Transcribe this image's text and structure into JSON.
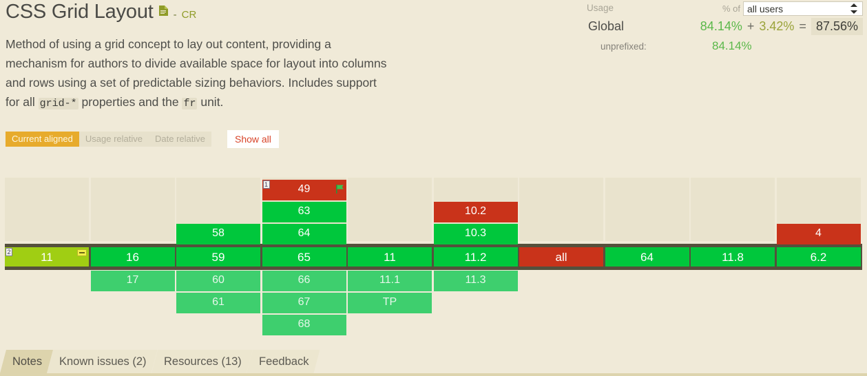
{
  "header": {
    "title": "CSS Grid Layout",
    "doc_icon": "document-icon",
    "dash": "-",
    "spec_status": "CR",
    "description_parts": {
      "p1": "Method of using a grid concept to lay out content, providing a mechanism for authors to divide available space for layout into columns and rows using a set of predictable sizing behaviors. Includes support for all ",
      "code1": "grid-*",
      "p2": " properties and the ",
      "code2": "fr",
      "p3": " unit."
    }
  },
  "usage": {
    "label": "Usage",
    "pct_of_label": "% of",
    "select_value": "all users",
    "global_label": "Global",
    "supported": "84.14%",
    "plus": "+",
    "partial": "3.42%",
    "equals": "=",
    "total": "87.56%",
    "unprefixed_label": "unprefixed:",
    "unprefixed_value": "84.14%"
  },
  "toolbar": {
    "segments": [
      {
        "label": "Current aligned",
        "active": true
      },
      {
        "label": "Usage relative",
        "active": false
      },
      {
        "label": "Date relative",
        "active": false
      }
    ],
    "show_all": "Show all"
  },
  "colors": {
    "page_bg": "#f0ead8",
    "empty_cell": "#e9e3cd",
    "supported": "#00c73c",
    "future": "#3ecf6e",
    "unsupported": "#c9331a",
    "partial": "#a0ce13",
    "highlight_band": "#55503c",
    "accent_orange": "#e7ab2c",
    "link_red": "#d8452a",
    "spec_green": "#8f9c28"
  },
  "support_grid": {
    "columns": [
      {
        "name": "ie",
        "above": [],
        "current": {
          "label": "11",
          "state": "partial",
          "badge": "2",
          "marker": "prefix-icon"
        },
        "below": []
      },
      {
        "name": "edge",
        "above": [],
        "current": {
          "label": "16",
          "state": "green"
        },
        "below": [
          {
            "label": "17",
            "state": "future"
          }
        ]
      },
      {
        "name": "firefox",
        "above": [
          {
            "label": "58",
            "state": "green"
          }
        ],
        "current": {
          "label": "59",
          "state": "green"
        },
        "below": [
          {
            "label": "60",
            "state": "future"
          },
          {
            "label": "61",
            "state": "future"
          }
        ]
      },
      {
        "name": "chrome",
        "above": [
          {
            "label": "49",
            "state": "red",
            "badge": "1",
            "marker": "flag-icon"
          },
          {
            "label": "63",
            "state": "green"
          },
          {
            "label": "64",
            "state": "green"
          }
        ],
        "current": {
          "label": "65",
          "state": "green"
        },
        "below": [
          {
            "label": "66",
            "state": "future"
          },
          {
            "label": "67",
            "state": "future"
          },
          {
            "label": "68",
            "state": "future"
          }
        ]
      },
      {
        "name": "safari",
        "above": [],
        "current": {
          "label": "11",
          "state": "green"
        },
        "below": [
          {
            "label": "11.1",
            "state": "future"
          },
          {
            "label": "TP",
            "state": "future"
          }
        ]
      },
      {
        "name": "opera",
        "above": [
          {
            "label": "10.2",
            "state": "red"
          },
          {
            "label": "10.3",
            "state": "green"
          }
        ],
        "current": {
          "label": "11.2",
          "state": "green"
        },
        "below": [
          {
            "label": "11.3",
            "state": "future"
          }
        ]
      },
      {
        "name": "ie-mobile",
        "above": [],
        "current": {
          "label": "all",
          "state": "red"
        },
        "below": []
      },
      {
        "name": "android-browser",
        "above": [],
        "current": {
          "label": "64",
          "state": "green"
        },
        "below": []
      },
      {
        "name": "opera-mobile",
        "above": [],
        "current": {
          "label": "11.8",
          "state": "green"
        },
        "below": []
      },
      {
        "name": "ios-safari",
        "above": [
          {
            "label": "4",
            "state": "red"
          }
        ],
        "current": {
          "label": "6.2",
          "state": "green"
        },
        "below": []
      }
    ]
  },
  "tabs": [
    {
      "label": "Notes",
      "active": true
    },
    {
      "label": "Known issues (2)",
      "active": false
    },
    {
      "label": "Resources (13)",
      "active": false
    },
    {
      "label": "Feedback",
      "active": false
    }
  ]
}
